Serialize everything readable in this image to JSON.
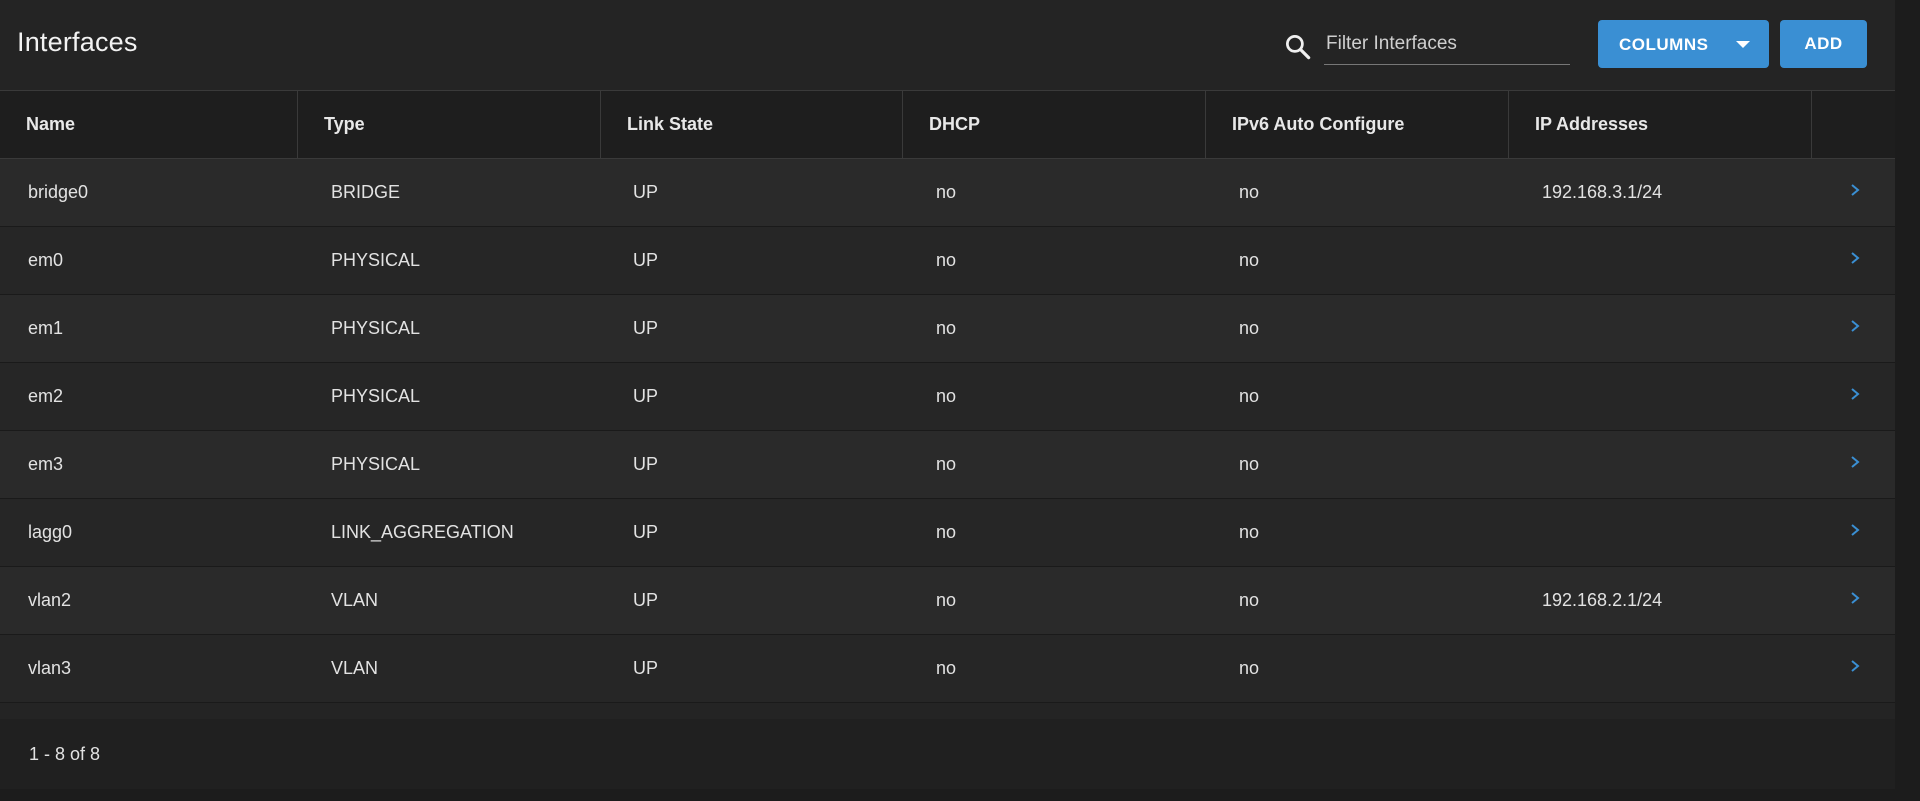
{
  "header": {
    "title": "Interfaces",
    "search_icon": "search-icon",
    "search_placeholder": "Filter Interfaces",
    "search_value": "",
    "columns_button": "COLUMNS",
    "add_button": "ADD"
  },
  "table": {
    "columns": [
      "Name",
      "Type",
      "Link State",
      "DHCP",
      "IPv6 Auto Configure",
      "IP Addresses"
    ],
    "rows": [
      {
        "name": "bridge0",
        "type": "BRIDGE",
        "link_state": "UP",
        "dhcp": "no",
        "ipv6": "no",
        "ip": "192.168.3.1/24"
      },
      {
        "name": "em0",
        "type": "PHYSICAL",
        "link_state": "UP",
        "dhcp": "no",
        "ipv6": "no",
        "ip": ""
      },
      {
        "name": "em1",
        "type": "PHYSICAL",
        "link_state": "UP",
        "dhcp": "no",
        "ipv6": "no",
        "ip": ""
      },
      {
        "name": "em2",
        "type": "PHYSICAL",
        "link_state": "UP",
        "dhcp": "no",
        "ipv6": "no",
        "ip": ""
      },
      {
        "name": "em3",
        "type": "PHYSICAL",
        "link_state": "UP",
        "dhcp": "no",
        "ipv6": "no",
        "ip": ""
      },
      {
        "name": "lagg0",
        "type": "LINK_AGGREGATION",
        "link_state": "UP",
        "dhcp": "no",
        "ipv6": "no",
        "ip": ""
      },
      {
        "name": "vlan2",
        "type": "VLAN",
        "link_state": "UP",
        "dhcp": "no",
        "ipv6": "no",
        "ip": "192.168.2.1/24"
      },
      {
        "name": "vlan3",
        "type": "VLAN",
        "link_state": "UP",
        "dhcp": "no",
        "ipv6": "no",
        "ip": ""
      }
    ],
    "row_action_icon": "chevron-right-icon"
  },
  "footer": {
    "range_text": "1 - 8 of 8"
  },
  "colors": {
    "accent": "#3a8fd3",
    "background": "#242424",
    "header_bg": "#1e1e1e"
  }
}
